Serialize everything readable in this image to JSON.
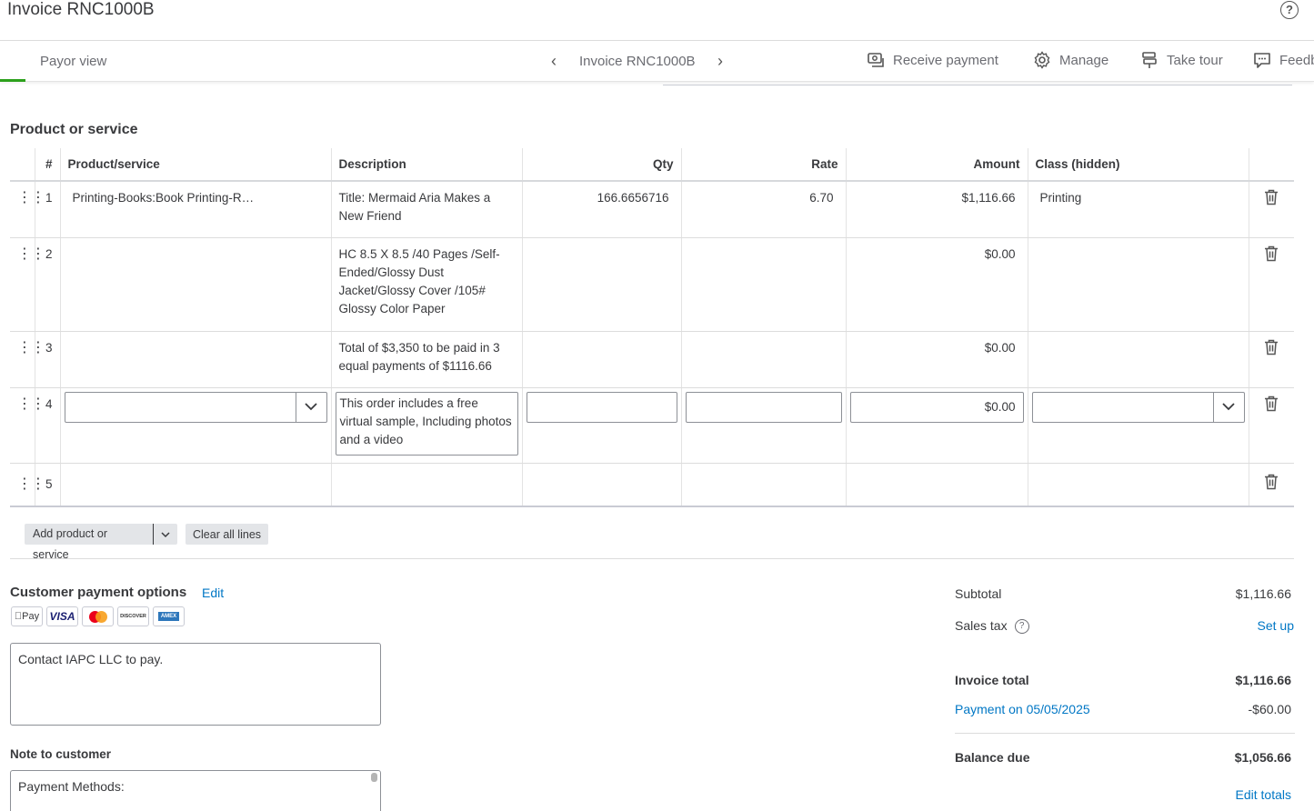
{
  "header": {
    "title": "Invoice RNC1000B",
    "help_icon": "question-circle-icon"
  },
  "subnav": {
    "payor_view": "Payor view",
    "invoice_label": "Invoice RNC1000B",
    "actions": [
      {
        "label": "Receive payment",
        "icon": "receive-payment-icon"
      },
      {
        "label": "Manage",
        "icon": "gear-icon"
      },
      {
        "label": "Take tour",
        "icon": "signpost-icon"
      },
      {
        "label": "Feedb",
        "icon": "feedback-bubble-icon"
      }
    ],
    "accent_color": "#2ca01c"
  },
  "section": {
    "title": "Product or service"
  },
  "table": {
    "headers": {
      "num": "#",
      "product": "Product/service",
      "description": "Description",
      "qty": "Qty",
      "rate": "Rate",
      "amount": "Amount",
      "class": "Class (hidden)"
    },
    "rows": [
      {
        "num": "1",
        "product": "Printing-Books:Book Printing-R…",
        "description": "Title: Mermaid Aria Makes a New Friend",
        "qty": "166.6656716",
        "rate": "6.70",
        "amount": "$1,116.66",
        "class": "Printing"
      },
      {
        "num": "2",
        "product": "",
        "description": "HC 8.5 X 8.5 /40 Pages /Self-Ended/Glossy Dust Jacket/Glossy Cover /105# Glossy Color Paper",
        "qty": "",
        "rate": "",
        "amount": "$0.00",
        "class": ""
      },
      {
        "num": "3",
        "product": "",
        "description": "Total of $3,350  to be paid in 3 equal payments of $1116.66",
        "qty": "",
        "rate": "",
        "amount": "$0.00",
        "class": ""
      },
      {
        "num": "4",
        "product": "",
        "description": "This order includes a free virtual sample, Including photos and a video",
        "qty": "",
        "rate": "",
        "amount": "$0.00",
        "class": ""
      },
      {
        "num": "5",
        "product": "",
        "description": "",
        "qty": "",
        "rate": "",
        "amount": "",
        "class": ""
      }
    ]
  },
  "buttons": {
    "add": "Add product or service",
    "clear": "Clear all lines"
  },
  "payment_options": {
    "title": "Customer payment options",
    "edit": "Edit",
    "cards": [
      "Pay",
      "VISA",
      "",
      "DISCOVER",
      "AMEX"
    ],
    "message": "Contact IAPC LLC to pay."
  },
  "note": {
    "label": "Note to customer",
    "text": "Payment Methods:"
  },
  "totals": {
    "subtotal_label": "Subtotal",
    "subtotal": "$1,116.66",
    "sales_tax_label": "Sales tax",
    "sales_tax_action": "Set up",
    "invoice_total_label": "Invoice total",
    "invoice_total": "$1,116.66",
    "payment_label": "Payment on 05/05/2025",
    "payment": "-$60.00",
    "balance_due_label": "Balance due",
    "balance_due": "$1,056.66",
    "edit_totals": "Edit totals"
  }
}
